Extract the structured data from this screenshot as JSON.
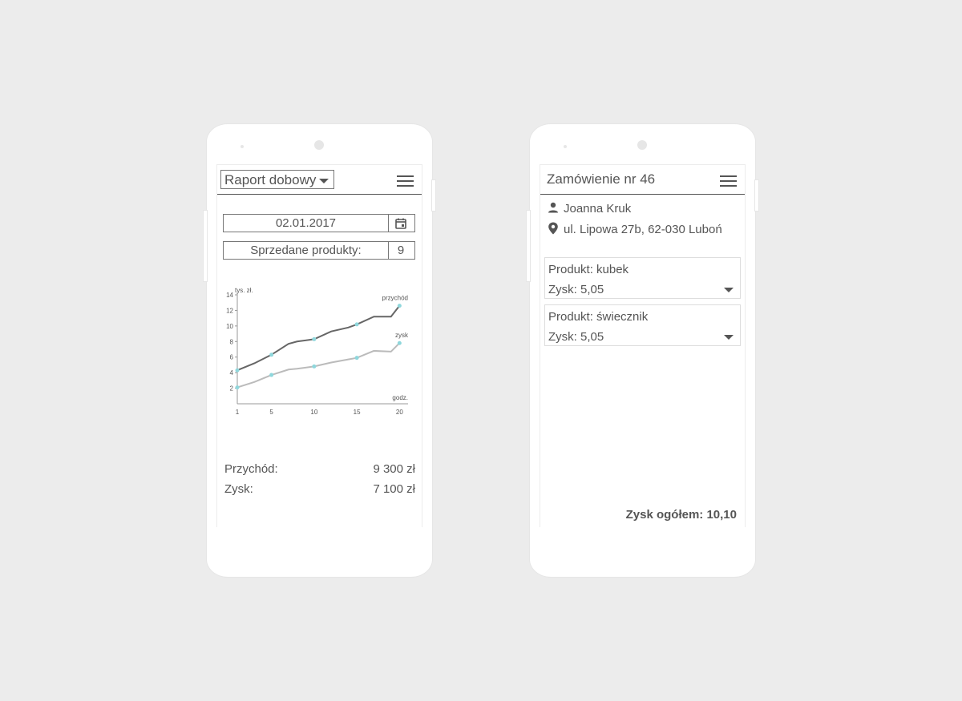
{
  "left_phone": {
    "report_select": "Raport dobowy",
    "date": "02.01.2017",
    "sold_label": "Sprzedane produkty:",
    "sold_count": "9",
    "revenue_label": "Przychód:",
    "revenue_value": "9 300 zł",
    "profit_label": "Zysk:",
    "profit_value": "7 100 zł"
  },
  "right_phone": {
    "title": "Zamówienie nr 46",
    "customer_name": "Joanna Kruk",
    "address": "ul. Lipowa 27b, 62-030 Luboń",
    "products": [
      {
        "name": "Produkt: kubek",
        "profit": "Zysk: 5,05"
      },
      {
        "name": "Produkt: świecznik",
        "profit": "Zysk: 5,05"
      }
    ],
    "total": "Zysk ogółem: 10,10"
  },
  "icons": {
    "menu": "hamburger-icon",
    "calendar": "calendar-icon",
    "person": "person-icon",
    "location": "location-pin-icon",
    "dropdown": "caret-down-icon"
  },
  "colors": {
    "revenue_line": "#666666",
    "profit_line": "#bbbbbb",
    "marker": "#8fd7dc"
  },
  "chart_data": {
    "type": "line",
    "ylabel": "tys. zł.",
    "xlabel": "godz.",
    "x_ticks": [
      1,
      5,
      10,
      15,
      20
    ],
    "y_ticks": [
      2,
      4,
      6,
      8,
      10,
      12,
      14
    ],
    "xlim": [
      1,
      21
    ],
    "ylim": [
      0,
      14
    ],
    "grid": false,
    "series": [
      {
        "name": "przychód",
        "x": [
          1,
          3,
          5,
          7,
          8,
          10,
          12,
          14,
          15,
          17,
          19,
          20
        ],
        "y": [
          4.3,
          5.2,
          6.3,
          7.7,
          8.0,
          8.3,
          9.3,
          9.8,
          10.2,
          11.2,
          11.2,
          12.6
        ],
        "markers_at": [
          1,
          5,
          10,
          15,
          20
        ]
      },
      {
        "name": "zysk",
        "x": [
          1,
          3,
          5,
          7,
          8,
          10,
          12,
          14,
          15,
          17,
          19,
          20
        ],
        "y": [
          2.1,
          2.8,
          3.7,
          4.4,
          4.5,
          4.8,
          5.3,
          5.7,
          5.9,
          6.8,
          6.7,
          7.8
        ],
        "markers_at": [
          1,
          5,
          10,
          15,
          20
        ]
      }
    ]
  }
}
